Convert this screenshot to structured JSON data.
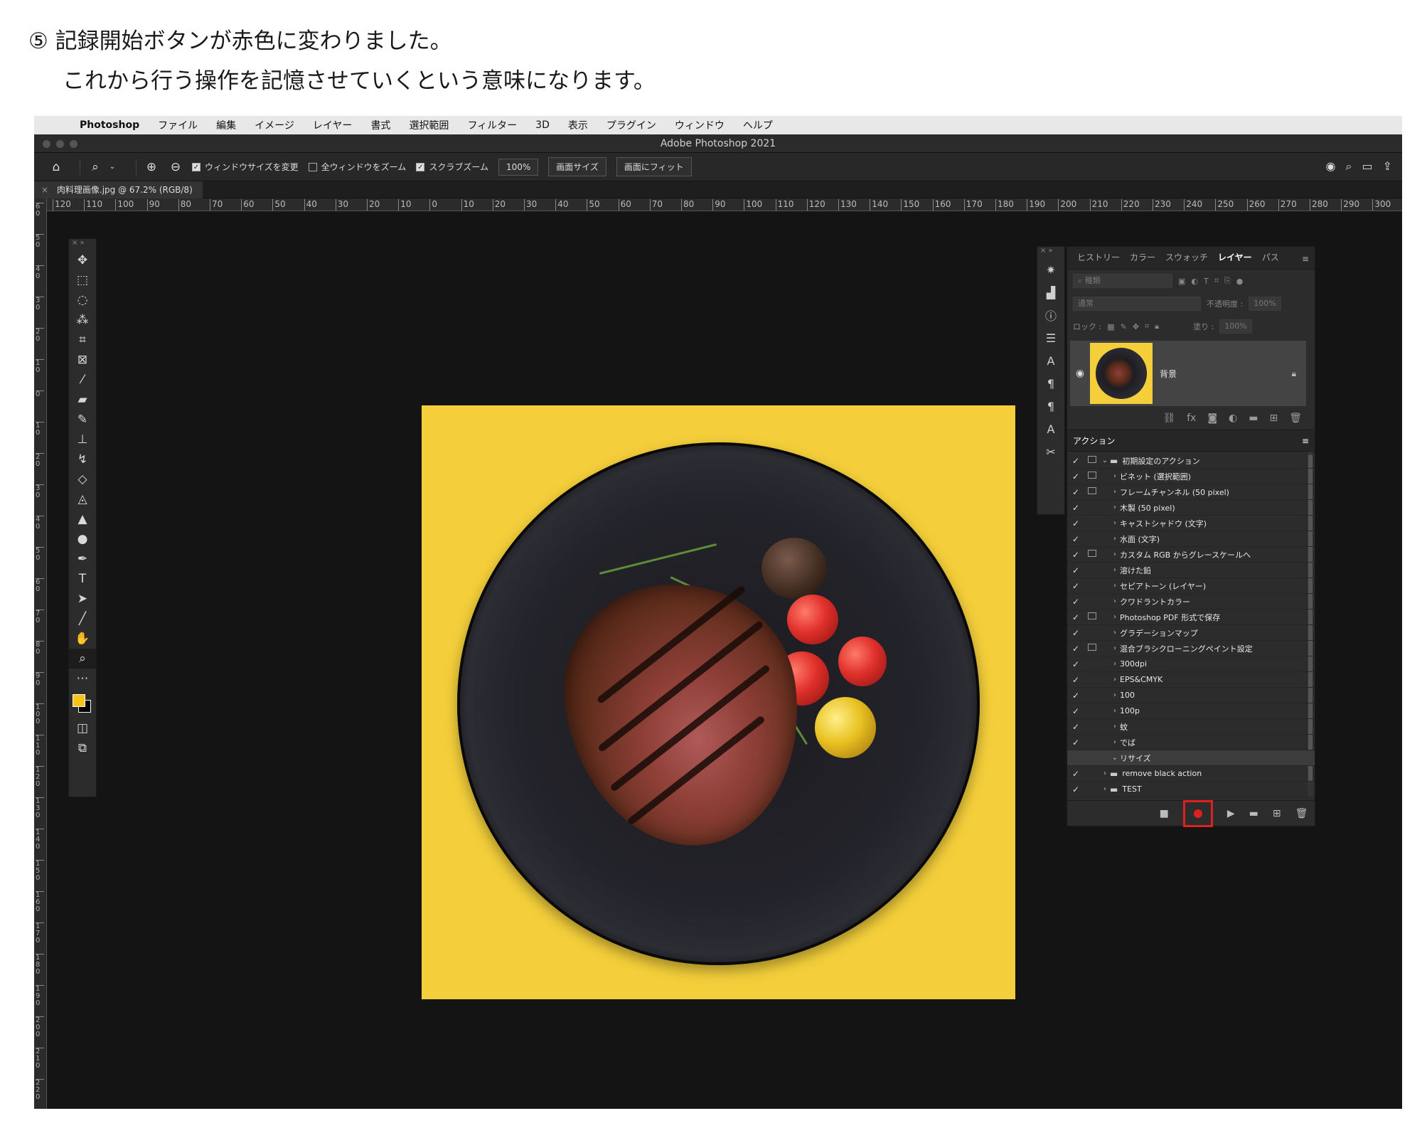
{
  "instruction": {
    "line1": "⑤ 記録開始ボタンが赤色に変わりました。",
    "line2": "これから行う操作を記憶させていくという意味になります。"
  },
  "menubar": {
    "app": "Photoshop",
    "items": [
      "ファイル",
      "編集",
      "イメージ",
      "レイヤー",
      "書式",
      "選択範囲",
      "フィルター",
      "3D",
      "表示",
      "プラグイン",
      "ウィンドウ",
      "ヘルプ"
    ]
  },
  "window_title": "Adobe Photoshop 2021",
  "options_bar": {
    "resize_windows": "ウィンドウサイズを変更",
    "zoom_all": "全ウィンドウをズーム",
    "scrubby_zoom": "スクラブズーム",
    "zoom_value": "100%",
    "fit_screen": "画面サイズ",
    "fill_screen": "画面にフィット"
  },
  "document_tab": "肉料理画像.jpg @ 67.2% (RGB/8)",
  "ruler_ticks": [
    "120",
    "110",
    "100",
    "90",
    "80",
    "70",
    "60",
    "50",
    "40",
    "30",
    "20",
    "10",
    "0",
    "10",
    "20",
    "30",
    "40",
    "50",
    "60",
    "70",
    "80",
    "90",
    "100",
    "110",
    "120",
    "130",
    "140",
    "150",
    "160",
    "170",
    "180",
    "190",
    "200",
    "210",
    "220",
    "230",
    "240",
    "250",
    "260",
    "270",
    "280",
    "290",
    "300"
  ],
  "vruler_ticks": [
    "6\n0",
    "5\n0",
    "4\n0",
    "3\n0",
    "2\n0",
    "1\n0",
    "0",
    "1\n0",
    "2\n0",
    "3\n0",
    "4\n0",
    "5\n0",
    "6\n0",
    "7\n0",
    "8\n0",
    "9\n0",
    "1\n0\n0",
    "1\n1\n0",
    "1\n2\n0",
    "1\n3\n0",
    "1\n4\n0",
    "1\n5\n0",
    "1\n6\n0",
    "1\n7\n0",
    "1\n8\n0",
    "1\n9\n0",
    "2\n0\n0",
    "2\n1\n0",
    "2\n2\n0"
  ],
  "panel_tabs": {
    "history": "ヒストリー",
    "color": "カラー",
    "swatches": "スウォッチ",
    "layers": "レイヤー",
    "paths": "パス"
  },
  "layers_panel": {
    "filter_placeholder": "種類",
    "blend_mode": "通常",
    "opacity_label": "不透明度 :",
    "opacity_value": "100%",
    "lock_label": "ロック :",
    "fill_label": "塗り :",
    "fill_value": "100%",
    "layer_name": "背景"
  },
  "actions_panel": {
    "title": "アクション",
    "set_name": "初期設定のアクション",
    "items": [
      {
        "label": "ビネット (選択範囲)",
        "dialog": true
      },
      {
        "label": "フレームチャンネル (50 pixel)",
        "dialog": true
      },
      {
        "label": "木製 (50 pixel)",
        "dialog": false
      },
      {
        "label": "キャストシャドウ (文字)",
        "dialog": false
      },
      {
        "label": "水面 (文字)",
        "dialog": false
      },
      {
        "label": "カスタム RGB からグレースケールへ",
        "dialog": true
      },
      {
        "label": "溶けた鉛",
        "dialog": false
      },
      {
        "label": "セピアトーン (レイヤー)",
        "dialog": false
      },
      {
        "label": "クワドラントカラー",
        "dialog": false
      },
      {
        "label": "Photoshop PDF 形式で保存",
        "dialog": true
      },
      {
        "label": "グラデーションマップ",
        "dialog": false
      },
      {
        "label": "混合ブラシクローニングペイント設定",
        "dialog": true
      },
      {
        "label": "300dpi",
        "dialog": false
      },
      {
        "label": "EPS&CMYK",
        "dialog": false
      },
      {
        "label": "100",
        "dialog": false
      },
      {
        "label": "100p",
        "dialog": false
      },
      {
        "label": "蚊",
        "dialog": false
      },
      {
        "label": "でば",
        "dialog": false
      }
    ],
    "recording_item": "リサイズ",
    "sets_after": [
      "remove black action",
      "TEST"
    ]
  },
  "colors": {
    "accent_red": "#e0201c",
    "foreground": "#f5c518",
    "canvas_bg": "#f4cf3b"
  }
}
